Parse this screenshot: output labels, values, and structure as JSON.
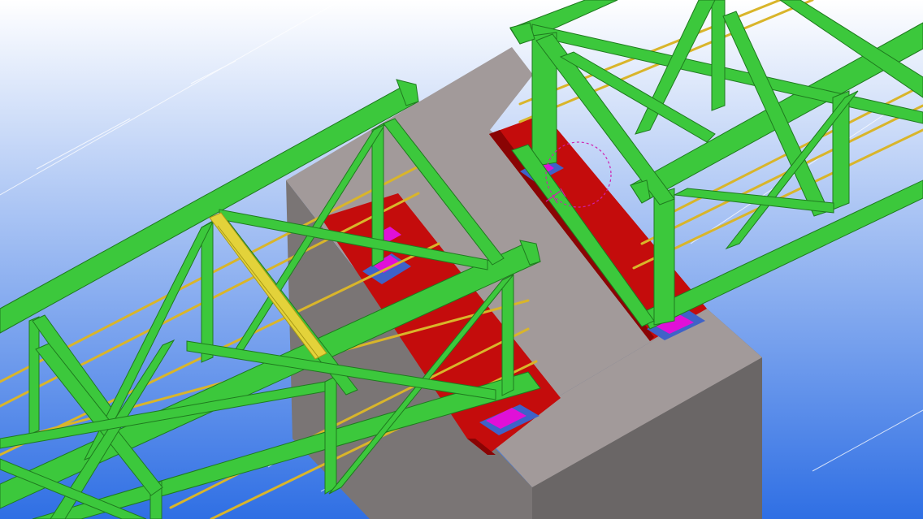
{
  "viewport": {
    "background_top": "#ffffff",
    "background_bottom": "#2f6fe4"
  },
  "colors": {
    "truss_steel": "#3cc83c",
    "truss_steel_dark": "#259a25",
    "truss_steel_edge": "#1f7a1f",
    "selected_brace": "#e3d23a",
    "selected_brace_dark": "#a99a16",
    "tie_rods": "#d9b52a",
    "concrete_top": "#a29a9a",
    "concrete_side": "#6a6666",
    "concrete_front": "#7a7575",
    "bearing_plate": "#c40c0c",
    "bearing_plate_dark": "#8a0404",
    "bearing_block": "#e010d8",
    "bearing_base": "#3f62c8",
    "work_plane": "#ffffff",
    "highlight_circle": "#d020b0"
  },
  "scene_objects": [
    {
      "name": "left-truss",
      "kind": "steel-truss"
    },
    {
      "name": "right-truss",
      "kind": "steel-truss"
    },
    {
      "name": "concrete-pier",
      "kind": "concrete-column"
    },
    {
      "name": "bearing-seat-left",
      "kind": "embedded-plate"
    },
    {
      "name": "bearing-seat-right",
      "kind": "embedded-plate"
    },
    {
      "name": "selected-diagonal-brace",
      "kind": "steel-member",
      "selected": true
    }
  ]
}
